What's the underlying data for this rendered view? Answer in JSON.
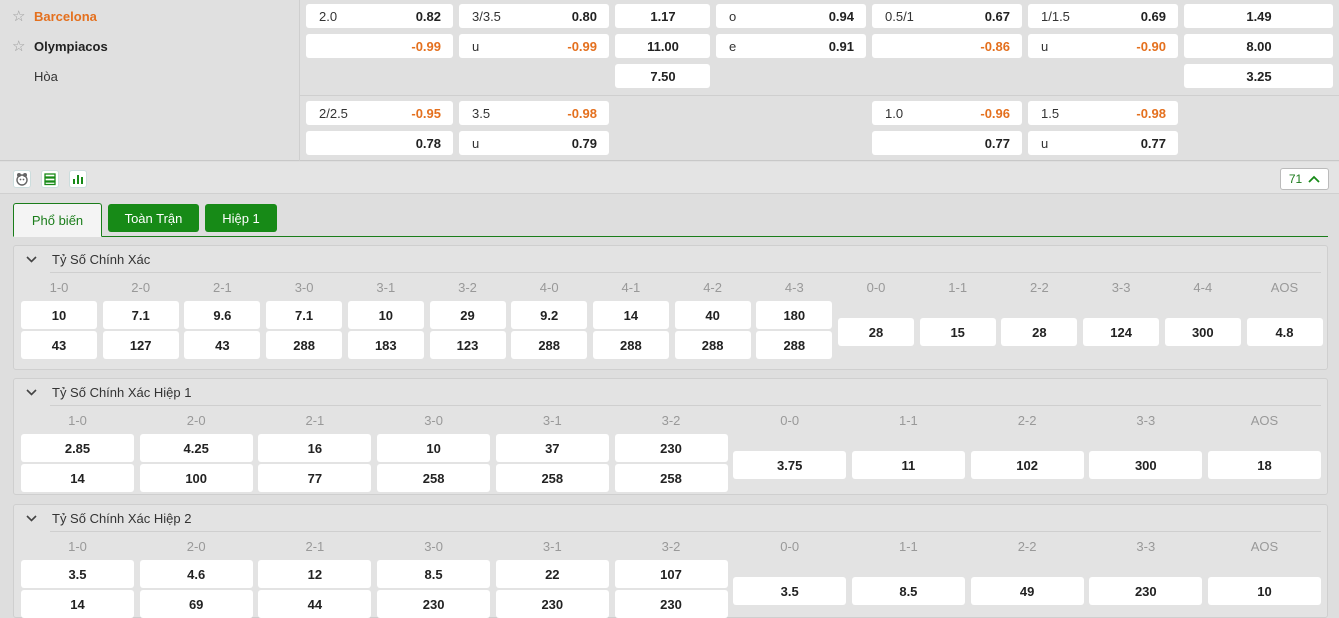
{
  "match": {
    "home": "Barcelona",
    "away": "Olympiacos",
    "draw": "Hòa"
  },
  "odds_rows": {
    "row1": [
      {
        "label": "2.0",
        "value": "0.82",
        "neg": false
      },
      {
        "label": "3/3.5",
        "value": "0.80",
        "neg": false
      },
      {
        "label": "",
        "value": "1.17",
        "neg": false
      },
      {
        "label": "o",
        "value": "0.94",
        "neg": false
      },
      {
        "label": "0.5/1",
        "value": "0.67",
        "neg": false
      },
      {
        "label": "1/1.5",
        "value": "0.69",
        "neg": false
      },
      {
        "label": "",
        "value": "1.49",
        "neg": false
      }
    ],
    "row2": [
      {
        "label": "",
        "value": "-0.99",
        "neg": true
      },
      {
        "label": "u",
        "value": "-0.99",
        "neg": true
      },
      {
        "label": "",
        "value": "11.00",
        "neg": false
      },
      {
        "label": "e",
        "value": "0.91",
        "neg": false
      },
      {
        "label": "",
        "value": "-0.86",
        "neg": true
      },
      {
        "label": "u",
        "value": "-0.90",
        "neg": true
      },
      {
        "label": "",
        "value": "8.00",
        "neg": false
      }
    ],
    "row3": [
      {
        "label": "",
        "value": "7.50",
        "neg": false
      },
      {
        "label": "",
        "value": "3.25",
        "neg": false
      }
    ],
    "row4": [
      {
        "label": "2/2.5",
        "value": "-0.95",
        "neg": true
      },
      {
        "label": "3.5",
        "value": "-0.98",
        "neg": true
      },
      {
        "label": "1.0",
        "value": "-0.96",
        "neg": true
      },
      {
        "label": "1.5",
        "value": "-0.98",
        "neg": true
      }
    ],
    "row5": [
      {
        "label": "",
        "value": "0.78",
        "neg": false
      },
      {
        "label": "u",
        "value": "0.79",
        "neg": false
      },
      {
        "label": "",
        "value": "0.77",
        "neg": false
      },
      {
        "label": "u",
        "value": "0.77",
        "neg": false
      }
    ]
  },
  "toolbar": {
    "icons": [
      "mascot-icon",
      "list-icon",
      "stats-icon"
    ],
    "count": "71"
  },
  "tabs": [
    {
      "label": "Phổ biến",
      "active": true
    },
    {
      "label": "Toàn Trận",
      "active": false
    },
    {
      "label": "Hiệp 1",
      "active": false
    }
  ],
  "panels": [
    {
      "title": "Tỷ Số Chính Xác",
      "pairs": [
        {
          "score": "1-0",
          "home": "10",
          "away": "43"
        },
        {
          "score": "2-0",
          "home": "7.1",
          "away": "127"
        },
        {
          "score": "2-1",
          "home": "9.6",
          "away": "43"
        },
        {
          "score": "3-0",
          "home": "7.1",
          "away": "288"
        },
        {
          "score": "3-1",
          "home": "10",
          "away": "183"
        },
        {
          "score": "3-2",
          "home": "29",
          "away": "123"
        },
        {
          "score": "4-0",
          "home": "9.2",
          "away": "288"
        },
        {
          "score": "4-1",
          "home": "14",
          "away": "288"
        },
        {
          "score": "4-2",
          "home": "40",
          "away": "288"
        },
        {
          "score": "4-3",
          "home": "180",
          "away": "288"
        }
      ],
      "singles": [
        {
          "score": "0-0",
          "value": "28"
        },
        {
          "score": "1-1",
          "value": "15"
        },
        {
          "score": "2-2",
          "value": "28"
        },
        {
          "score": "3-3",
          "value": "124"
        },
        {
          "score": "4-4",
          "value": "300"
        },
        {
          "score": "AOS",
          "value": "4.8"
        }
      ]
    },
    {
      "title": "Tỷ Số Chính Xác Hiệp 1",
      "pairs": [
        {
          "score": "1-0",
          "home": "2.85",
          "away": "14"
        },
        {
          "score": "2-0",
          "home": "4.25",
          "away": "100"
        },
        {
          "score": "2-1",
          "home": "16",
          "away": "77"
        },
        {
          "score": "3-0",
          "home": "10",
          "away": "258"
        },
        {
          "score": "3-1",
          "home": "37",
          "away": "258"
        },
        {
          "score": "3-2",
          "home": "230",
          "away": "258"
        }
      ],
      "singles": [
        {
          "score": "0-0",
          "value": "3.75"
        },
        {
          "score": "1-1",
          "value": "11"
        },
        {
          "score": "2-2",
          "value": "102"
        },
        {
          "score": "3-3",
          "value": "300"
        },
        {
          "score": "AOS",
          "value": "18"
        }
      ]
    },
    {
      "title": "Tỷ Số Chính Xác Hiệp 2",
      "pairs": [
        {
          "score": "1-0",
          "home": "3.5",
          "away": "14"
        },
        {
          "score": "2-0",
          "home": "4.6",
          "away": "69"
        },
        {
          "score": "2-1",
          "home": "12",
          "away": "44"
        },
        {
          "score": "3-0",
          "home": "8.5",
          "away": "230"
        },
        {
          "score": "3-1",
          "home": "22",
          "away": "230"
        },
        {
          "score": "3-2",
          "home": "107",
          "away": "230"
        }
      ],
      "singles": [
        {
          "score": "0-0",
          "value": "3.5"
        },
        {
          "score": "1-1",
          "value": "8.5"
        },
        {
          "score": "2-2",
          "value": "49"
        },
        {
          "score": "3-3",
          "value": "230"
        },
        {
          "score": "AOS",
          "value": "10"
        }
      ]
    }
  ],
  "colors": {
    "accent_green": "#178a17",
    "home_orange": "#e4701e",
    "negative_orange": "#e4701e"
  }
}
